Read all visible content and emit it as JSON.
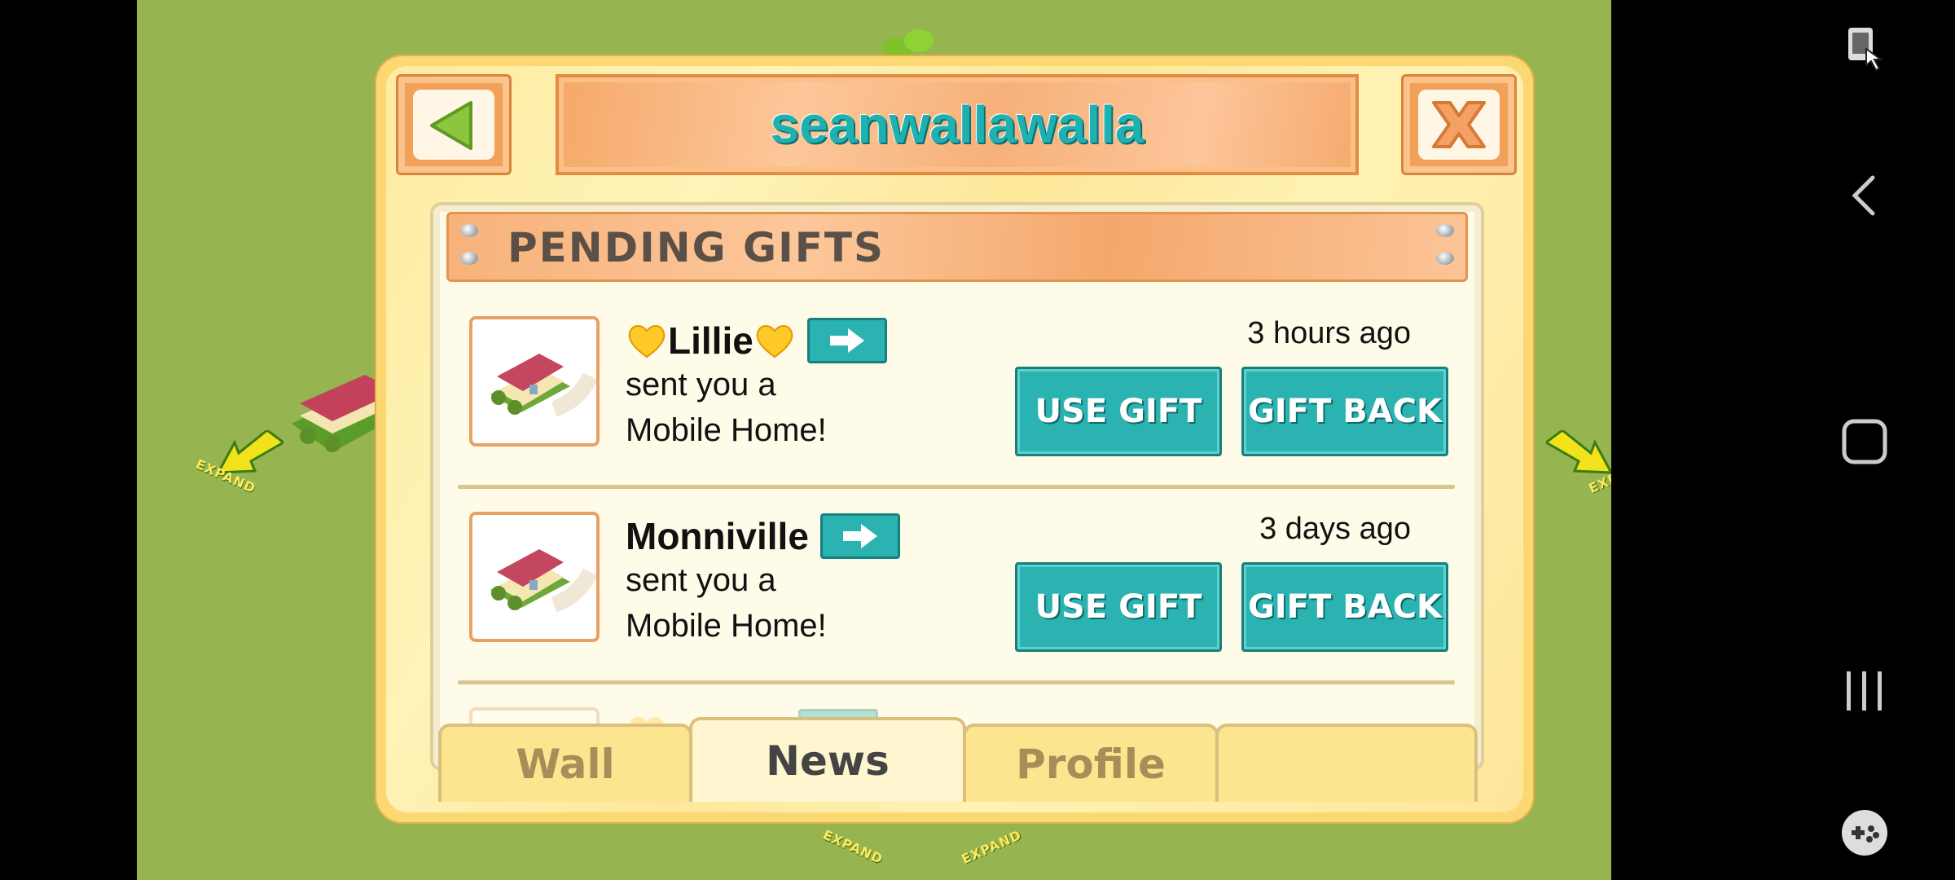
{
  "dialog": {
    "title": "seanwallawalla",
    "back_icon": "triangle-left-icon",
    "close_icon": "close-x-icon"
  },
  "pending_gifts": {
    "header": "PENDING GIFTS",
    "items": [
      {
        "sender": "Lillie",
        "sender_decoration": "yellow-heart-emoji",
        "message_line1": "sent you a",
        "message_line2": "Mobile Home!",
        "time": "3 hours ago",
        "use_label": "USE GIFT",
        "gift_back_label": "GIFT BACK"
      },
      {
        "sender": "Monniville",
        "message_line1": "sent you a",
        "message_line2": "Mobile Home!",
        "time": "3 days ago",
        "use_label": "USE GIFT",
        "gift_back_label": "GIFT BACK"
      }
    ]
  },
  "tabs": [
    {
      "label": "Wall",
      "active": false
    },
    {
      "label": "News",
      "active": true
    },
    {
      "label": "Profile",
      "active": false
    },
    {
      "label": "",
      "active": false
    }
  ],
  "game_background": {
    "expand_labels": [
      "EXPAND",
      "EXPAND",
      "EXPAND",
      "EXPAND"
    ]
  },
  "nav_bar": {
    "icons": [
      "screen-pin-icon",
      "back-chevron-icon",
      "home-square-icon",
      "recent-apps-icon",
      "game-tools-icon"
    ]
  },
  "colors": {
    "accent_teal": "#2ab3b1",
    "dialog_yellow": "#fbd872",
    "banner_orange": "#f6a869",
    "game_green": "#96b450"
  }
}
